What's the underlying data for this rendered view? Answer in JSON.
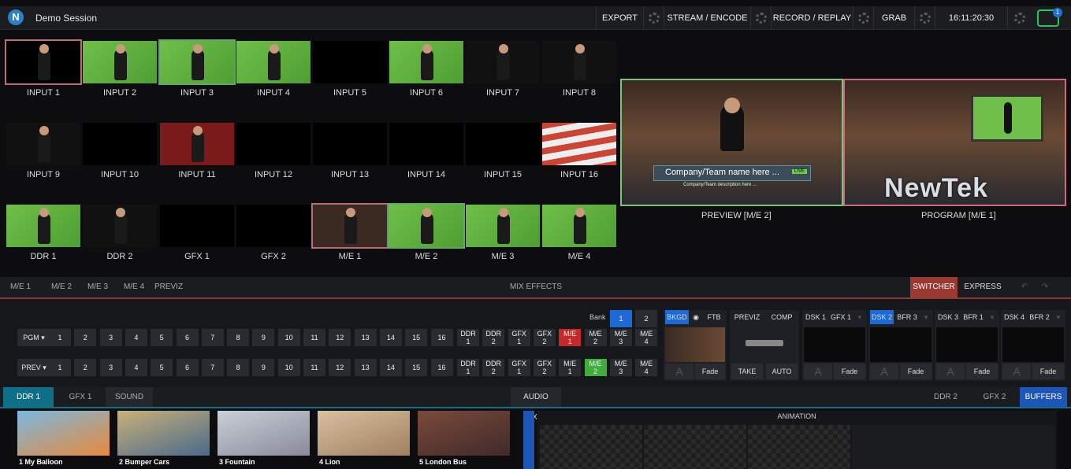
{
  "app": {
    "session_title": "Demo Session"
  },
  "topbar": {
    "export": "EXPORT",
    "stream": "STREAM / ENCODE",
    "record": "RECORD / REPLAY",
    "grab": "GRAB",
    "clock": "16:11:20:30",
    "notifications": "1"
  },
  "inputs": {
    "row1": [
      "INPUT 1",
      "INPUT 2",
      "INPUT 3",
      "INPUT 4",
      "INPUT 5",
      "INPUT 6",
      "INPUT 7",
      "INPUT 8"
    ],
    "row2": [
      "INPUT 9",
      "INPUT 10",
      "INPUT 11",
      "INPUT 12",
      "INPUT 13",
      "INPUT 14",
      "INPUT 15",
      "INPUT 16"
    ],
    "row3": [
      "DDR 1",
      "DDR 2",
      "GFX 1",
      "GFX 2",
      "M/E 1",
      "M/E 2",
      "M/E 3",
      "M/E 4"
    ]
  },
  "monitors": {
    "preview": "PREVIEW [M/E 2]",
    "program": "PROGRAM [M/E 1]",
    "lower_third_title": "Company/Team name here ...",
    "lower_third_desc": "Company/Team description here ...",
    "live_tag": "LIVE",
    "brand": "NewTek"
  },
  "me_tabs": {
    "items": [
      "M/E 1",
      "M/E 2",
      "M/E 3",
      "M/E 4",
      "PREVIZ"
    ],
    "center": "MIX EFFECTS",
    "switcher": "SWITCHER",
    "express": "EXPRESS"
  },
  "switcher": {
    "bank_label": "Bank",
    "banks": [
      "1",
      "2"
    ],
    "pgm": "PGM ▾",
    "prev": "PREV ▾",
    "nums": [
      "1",
      "2",
      "3",
      "4",
      "5",
      "6",
      "7",
      "8",
      "9",
      "10",
      "11",
      "12",
      "13",
      "14",
      "15",
      "16"
    ],
    "extras": [
      [
        "DDR",
        "1"
      ],
      [
        "DDR",
        "2"
      ],
      [
        "GFX",
        "1"
      ],
      [
        "GFX",
        "2"
      ],
      [
        "M/E",
        "1"
      ],
      [
        "M/E",
        "2"
      ],
      [
        "M/E",
        "3"
      ],
      [
        "M/E",
        "4"
      ]
    ],
    "bkgd": "BKGD",
    "ftb": "FTB",
    "previz": "PREVIZ",
    "comp": "COMP",
    "fade": "Fade",
    "take": "TAKE",
    "auto": "AUTO",
    "dsk": [
      [
        "DSK 1",
        "GFX 1"
      ],
      [
        "DSK 2",
        "BFR 3"
      ],
      [
        "DSK 3",
        "BFR 1"
      ],
      [
        "DSK 4",
        "BFR 2"
      ]
    ]
  },
  "media_tabs": {
    "ddr1": "DDR 1",
    "gfx1": "GFX 1",
    "sound": "SOUND",
    "audio_mixer": "AUDIO MIXER",
    "ddr2": "DDR 2",
    "gfx2": "GFX 2",
    "buffers": "BUFFERS"
  },
  "media": [
    "1 My Balloon",
    "2 Bumper Cars",
    "3 Fountain",
    "4 Lion",
    "5 London Bus"
  ],
  "animation": {
    "title": "ANIMATION"
  },
  "colors": {
    "accent_red": "#c42a2a",
    "accent_green": "#3fae3c",
    "accent_blue": "#1d6ad6",
    "preview_outline": "#7bc47e",
    "program_outline": "#c96b7c"
  }
}
